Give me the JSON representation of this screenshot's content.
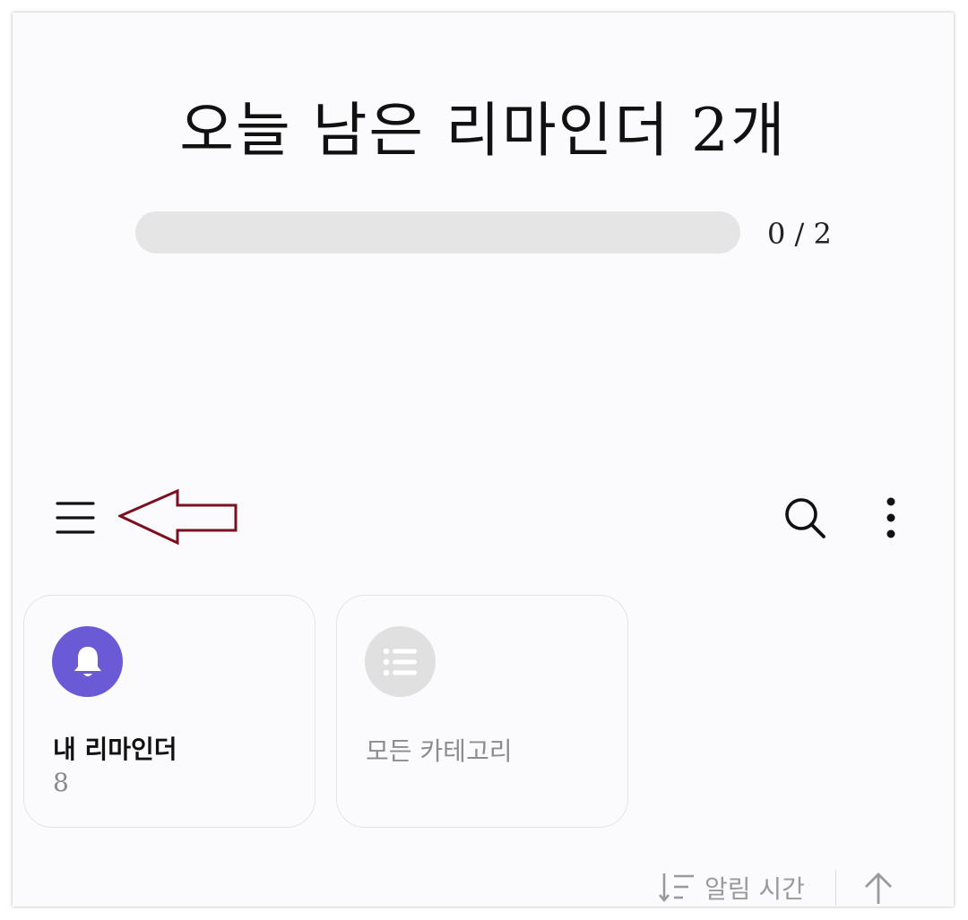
{
  "header": {
    "title": "오늘 남은 리마인더 2개",
    "progress_text": "0 / 2",
    "progress_fraction": 0
  },
  "toolbar": {
    "menu_icon": "hamburger-menu-icon",
    "search_icon": "search-icon",
    "more_icon": "more-vertical-icon",
    "annotation_icon": "left-arrow-annotation"
  },
  "categories": [
    {
      "label": "내 리마인더",
      "count": "8",
      "icon": "bell-icon",
      "color": "#6a5ad6"
    },
    {
      "label": "모든 카테고리",
      "count": "",
      "icon": "list-icon",
      "color": "#e0e0e0"
    }
  ],
  "sort": {
    "label": "알림 시간",
    "sort_icon": "sort-icon",
    "direction_icon": "arrow-up-icon"
  },
  "colors": {
    "accent": "#6a5ad6",
    "annotation_arrow": "#7a1020",
    "background": "#fbfbfd"
  }
}
